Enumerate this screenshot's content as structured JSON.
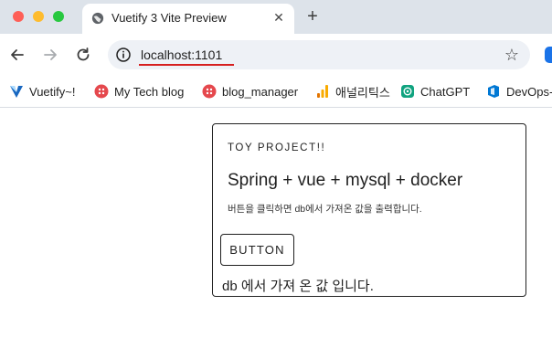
{
  "browser": {
    "tab": {
      "title": "Vuetify 3 Vite Preview"
    },
    "address_bar": {
      "url": "localhost:1101"
    },
    "bookmarks": [
      {
        "label": "Vuetify~!",
        "icon": "vuetify-icon"
      },
      {
        "label": "My Tech blog",
        "icon": "blog-icon"
      },
      {
        "label": "blog_manager",
        "icon": "blog-manager-icon"
      },
      {
        "label": "애널리틱스",
        "icon": "analytics-icon"
      },
      {
        "label": "ChatGPT",
        "icon": "chatgpt-icon"
      },
      {
        "label": "DevOps-",
        "icon": "devops-icon"
      }
    ]
  },
  "card": {
    "overline": "TOY PROJECT!!",
    "title": "Spring + vue + mysql + docker",
    "subtitle": "버튼을 클릭하면 db에서 가져온 값을 출력합니다.",
    "button_label": "BUTTON",
    "result_text": "db 에서 가져 온 값 입니다."
  },
  "colors": {
    "tab_strip": "#dde3ea",
    "url_underline": "#d61f1f",
    "vuetify": "#1867c0",
    "red_icon": "#e5484d",
    "analytics": "#f9ab00",
    "chatgpt": "#10a37f",
    "devops": "#0078d4"
  }
}
